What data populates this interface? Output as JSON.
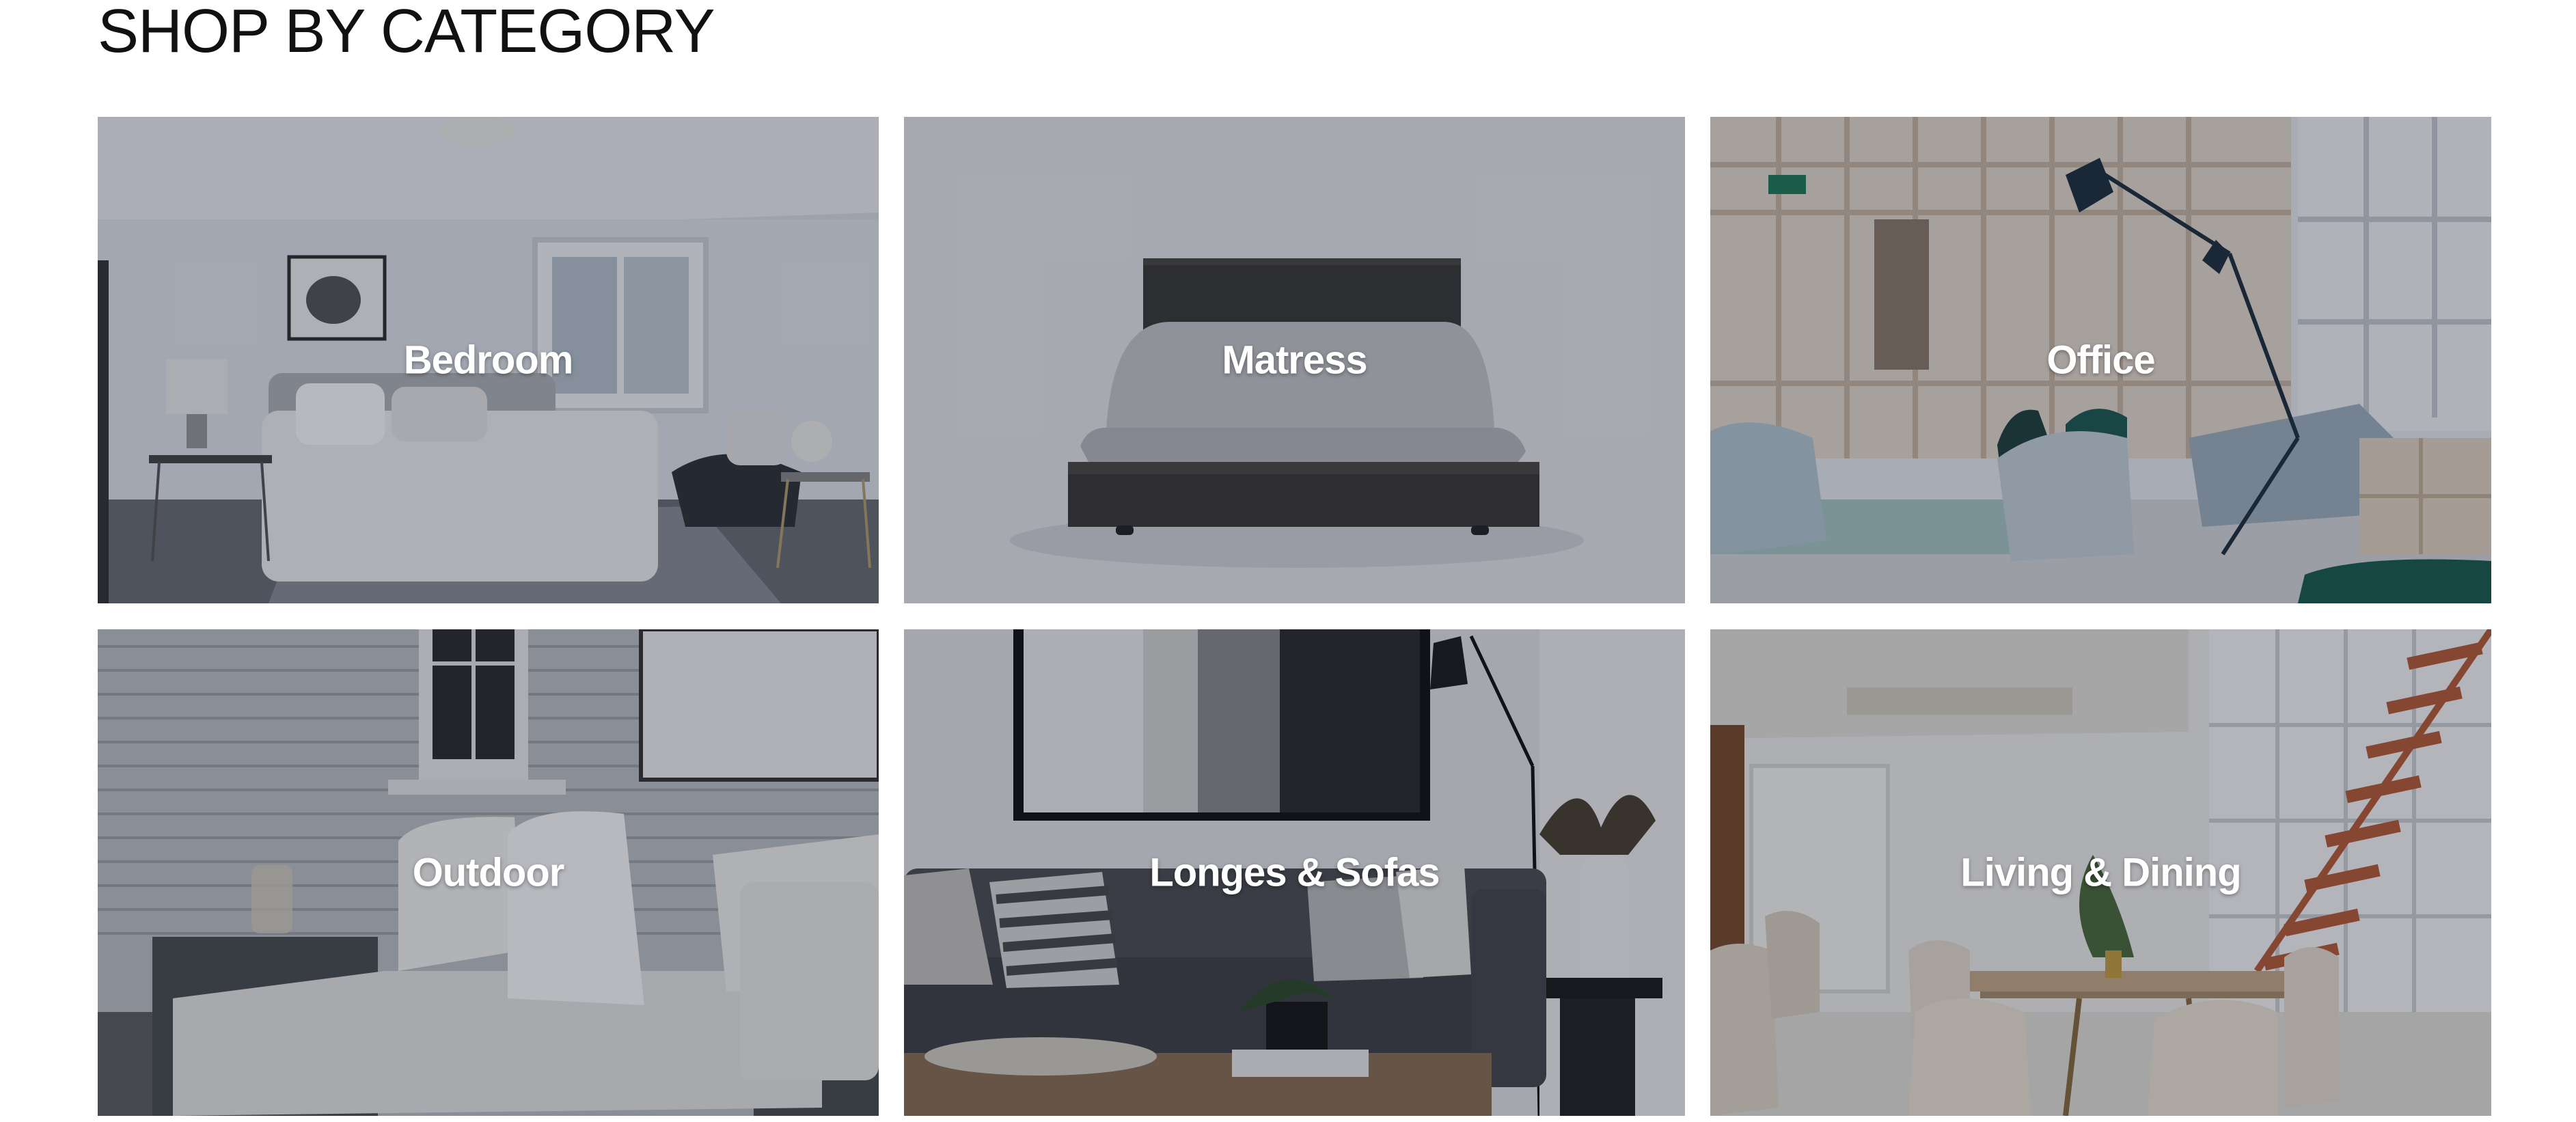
{
  "section": {
    "title": "SHOP BY CATEGORY"
  },
  "categories": [
    {
      "label": "Bedroom",
      "icon": "bedroom-photo"
    },
    {
      "label": "Matress",
      "icon": "mattress-photo"
    },
    {
      "label": "Office",
      "icon": "office-photo"
    },
    {
      "label": "Outdoor",
      "icon": "outdoor-photo"
    },
    {
      "label": "Longes & Sofas",
      "icon": "sofa-photo"
    },
    {
      "label": "Living & Dining",
      "icon": "dining-photo"
    }
  ],
  "colors": {
    "overlay": "#121828",
    "label_text": "#ffffff",
    "title_text": "#111111"
  }
}
